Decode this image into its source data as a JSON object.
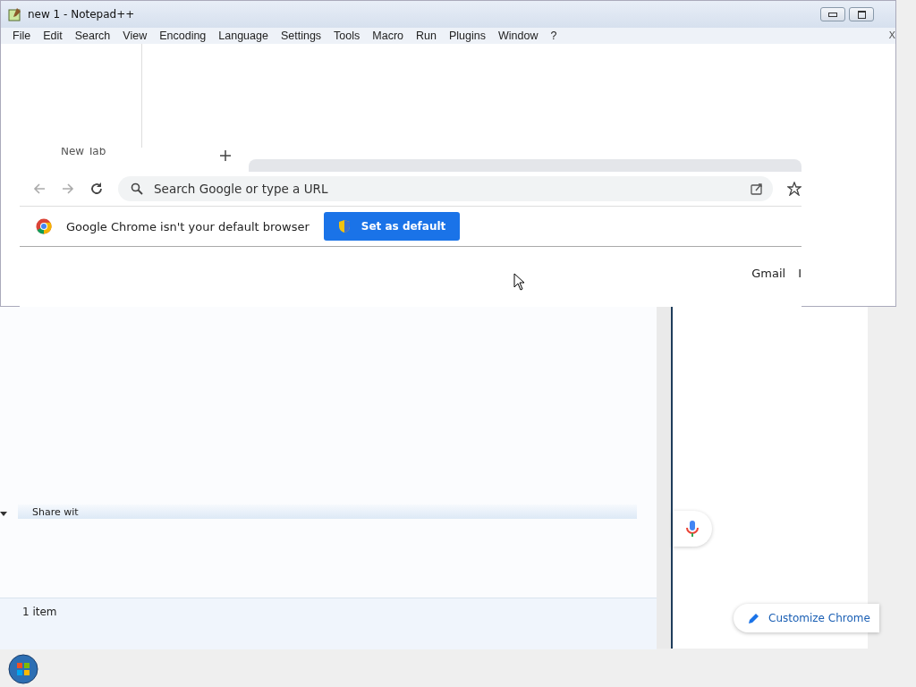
{
  "notepad": {
    "title": "new 1 - Notepad++",
    "menu": [
      {
        "label": "File"
      },
      {
        "label": "Edit"
      },
      {
        "label": "Search"
      },
      {
        "label": "View"
      },
      {
        "label": "Encoding"
      },
      {
        "label": "Language"
      },
      {
        "label": "Settings"
      },
      {
        "label": "Tools"
      },
      {
        "label": "Macro"
      },
      {
        "label": "Run"
      },
      {
        "label": "Plugins"
      },
      {
        "label": "Window"
      },
      {
        "label": "?"
      }
    ],
    "close_glyph": "X"
  },
  "chrome": {
    "tab": {
      "label": "New Tab"
    },
    "address": {
      "placeholder": "Search Google or type a URL"
    },
    "infobar": {
      "message": "Google Chrome isn't your default browser",
      "button": "Set as default"
    },
    "links": [
      "Gmail",
      "I"
    ],
    "customize": "Customize Chrome"
  },
  "explorer": {
    "toolbar_item": "Share wit",
    "status": "1 item"
  }
}
